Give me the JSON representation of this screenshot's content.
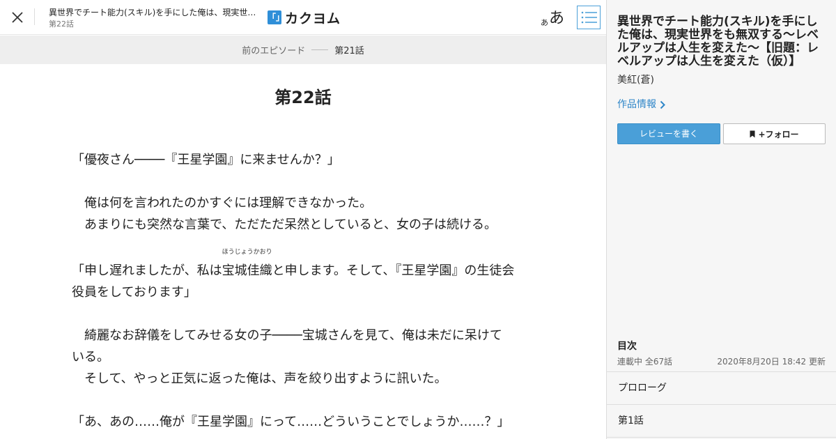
{
  "header": {
    "work_title": "異世界でチート能力(スキル)を手にした俺は、現実世界をも無双する～レベルアップは人生を変えた～【旧題：レベルアップは人生を変えた（仮）】",
    "episode": "第22話",
    "logo_mark": "「」",
    "logo_text": "カクヨム",
    "font_small": "あ",
    "font_large": "あ",
    "accent_color": "#2f8fd8"
  },
  "prev_nav": {
    "label": "前のエピソード",
    "episode": "第21話"
  },
  "episode_title": "第22話",
  "body": {
    "p1": "「優夜さん────『王星学園』に来ませんか？」",
    "p2": "　俺は何を言われたのかすぐには理解できなかった。",
    "p3": "　あまりにも突然な言葉で、ただただ呆然としていると、女の子は続ける。",
    "p4_pre": "「申し遅れましたが、私は",
    "p4_ruby_base": "宝城佳織",
    "p4_ruby_text": "ほうじょうかおり",
    "p4_post": "と申します。そして、『王星学園』の生徒会",
    "p4_line2": "役員をしております」",
    "p5_line1": "　綺麗なお辞儀をしてみせる女の子────宝城さんを見て、俺は未だに呆けて",
    "p5_line2": "いる。",
    "p6": "　そして、やっと正気に返った俺は、声を絞り出すように訊いた。",
    "p7": "「あ、あの……俺が『王星学園』にって……どういうことでしょうか……？」"
  },
  "sidebar": {
    "title": "異世界でチート能力(スキル)を手にした俺は、現実世界をも無双する～レベルアップは人生を変えた～【旧題：レベルアップは人生を変えた（仮）】",
    "author": "美紅(蒼)",
    "work_info": "作品情報",
    "review_button": "レビューを書く",
    "follow_button": "+フォロー",
    "toc_heading": "目次",
    "toc_status": "連載中 全67話",
    "toc_updated": "2020年8月20日 18:42 更新",
    "toc_items": [
      {
        "label": "プロローグ"
      },
      {
        "label": "第1話"
      }
    ]
  }
}
